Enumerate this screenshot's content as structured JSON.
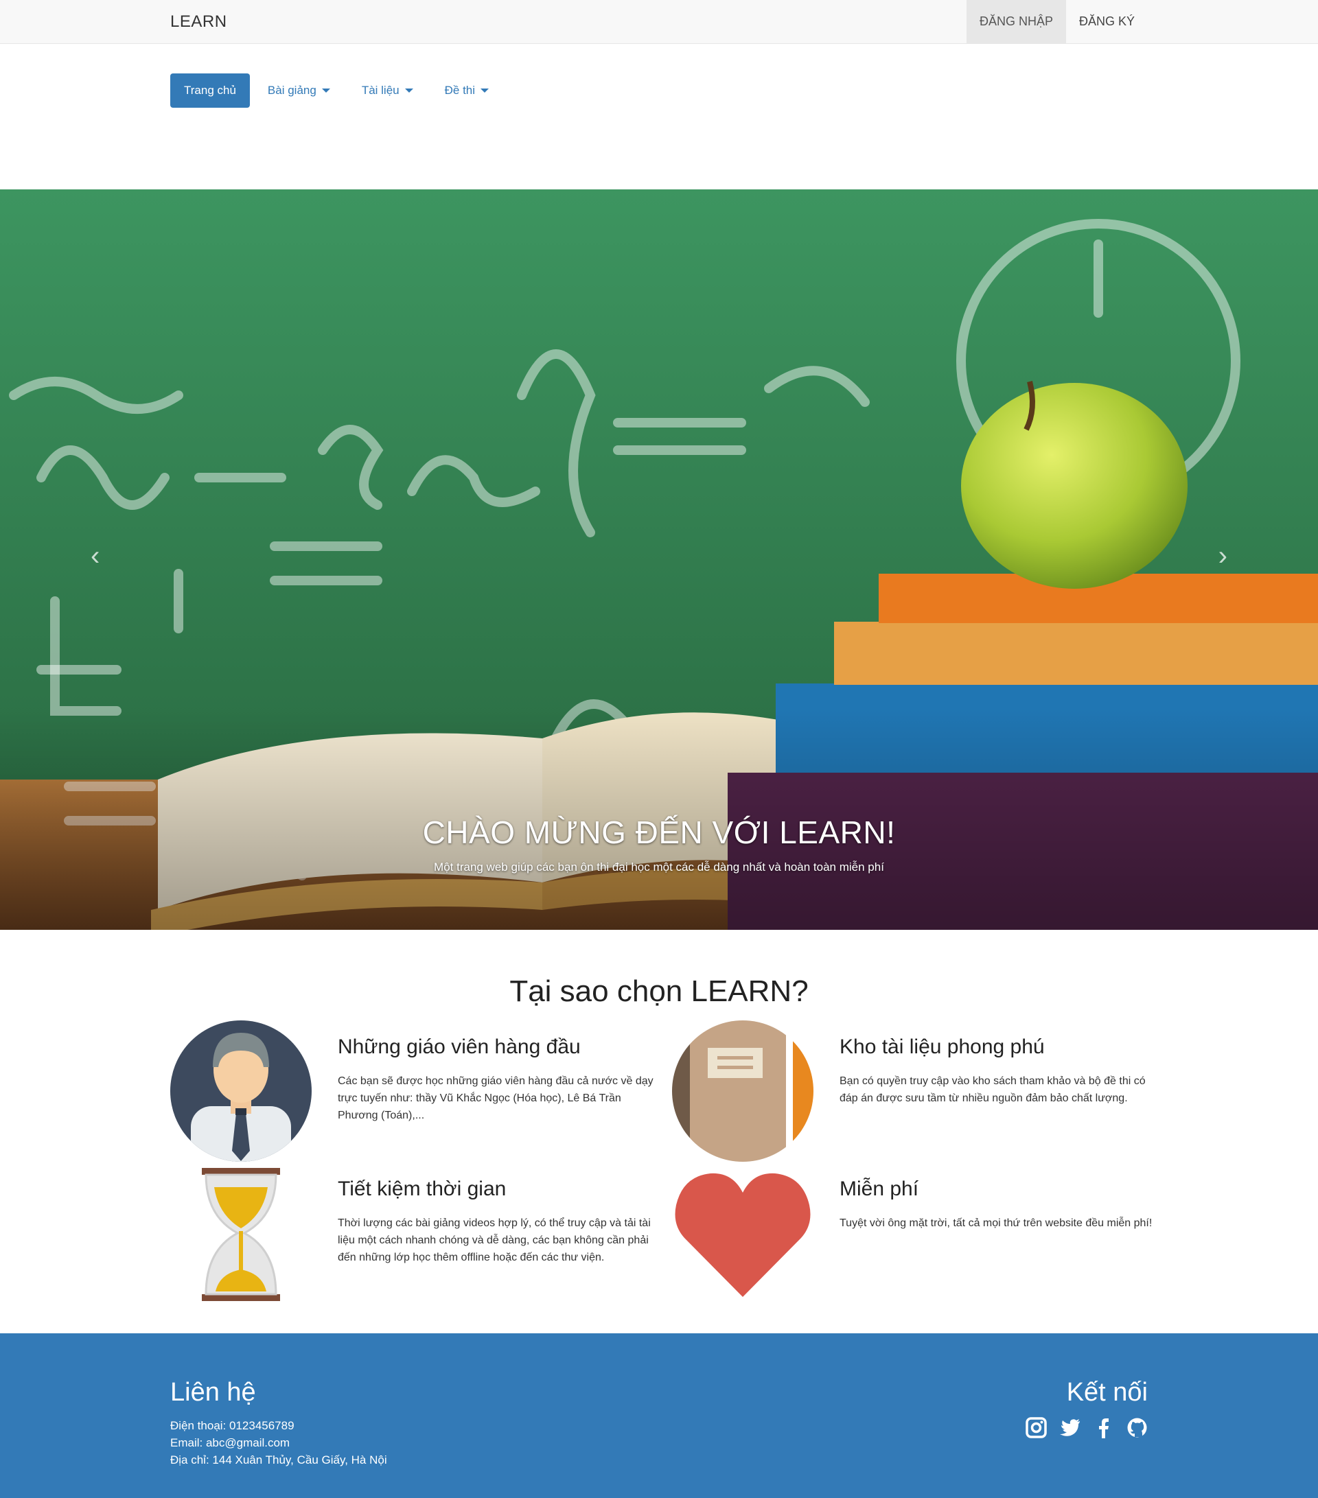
{
  "nav": {
    "brand": "LEARN",
    "login": "ĐĂNG NHẬP",
    "register": "ĐĂNG KÝ"
  },
  "menu": {
    "home": "Trang chủ",
    "lectures": "Bài giảng",
    "documents": "Tài liệu",
    "exams": "Đề thi"
  },
  "hero": {
    "title": "CHÀO MỪNG ĐẾN VỚI LEARN!",
    "subtitle": "Một trang web giúp các bạn ôn thi đại học một các dễ dàng nhất và hoàn toàn miễn phí",
    "prev": "‹",
    "next": "›"
  },
  "why": {
    "title": "Tại sao chọn LEARN?",
    "features": [
      {
        "icon": "teacher-icon",
        "title": "Những giáo viên hàng đầu",
        "text": "Các bạn sẽ được học những giáo viên hàng đầu cả nước về dạy trực tuyến như: thầy Vũ Khắc Ngọc (Hóa học), Lê Bá Trần Phương (Toán),..."
      },
      {
        "icon": "book-icon",
        "title": "Kho tài liệu phong phú",
        "text": "Bạn có quyền truy cập vào kho sách tham khảo và bộ đề thi có đáp án được sưu tầm từ nhiều nguồn đảm bảo chất lượng."
      },
      {
        "icon": "hourglass-icon",
        "title": "Tiết kiệm thời gian",
        "text": "Thời lượng các bài giảng videos hợp lý, có thể truy cập và tải tài liệu một cách nhanh chóng và dễ dàng, các bạn không cần phải đến những lớp học thêm offline hoặc đến các thư viện."
      },
      {
        "icon": "heart-icon",
        "title": "Miễn phí",
        "text": "Tuyệt vời ông mặt trời, tất cả mọi thứ trên website đều miễn phí!"
      }
    ]
  },
  "footer": {
    "contact_title": "Liên hệ",
    "phone": "Điện thoại: 0123456789",
    "email": "Email: abc@gmail.com",
    "address": "Địa chỉ: 144 Xuân Thủy, Cầu Giấy, Hà Nội",
    "connect_title": "Kết nối",
    "social": [
      "instagram-icon",
      "twitter-icon",
      "facebook-icon",
      "github-icon"
    ]
  },
  "colors": {
    "primary": "#337ab7",
    "navbar": "#f8f8f8",
    "heart": "#d9574b",
    "hourglass_sand": "#e8b413"
  }
}
